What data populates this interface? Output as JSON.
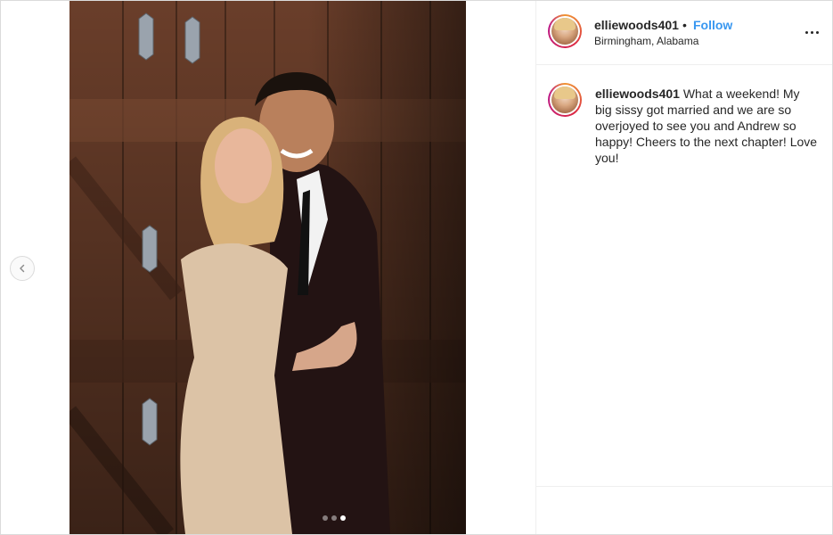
{
  "post": {
    "username": "elliewoods401",
    "separator": "•",
    "follow_label": "Follow",
    "location": "Birmingham, Alabama",
    "more_icon": "more-options-icon"
  },
  "caption": {
    "username": "elliewoods401",
    "text": "What a weekend! My big sissy got married and we are so overjoyed to see you and Andrew so happy! Cheers to the next chapter! Love you!"
  },
  "carousel": {
    "prev_icon": "chevron-left-icon",
    "slide_count": 3,
    "active_index": 2
  },
  "colors": {
    "follow": "#3897f0",
    "text": "#262626",
    "border": "#dbdbdb"
  }
}
